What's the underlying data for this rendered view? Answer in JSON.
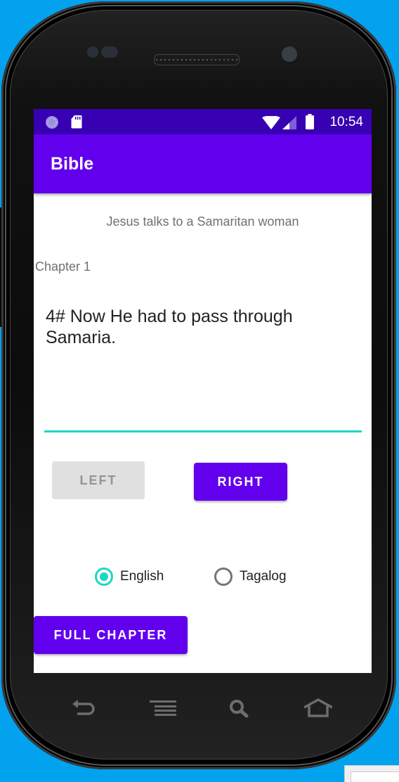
{
  "status_bar": {
    "time": "10:54",
    "left_icons": [
      "sync-icon",
      "sd-card-icon"
    ],
    "right_icons": [
      "wifi-icon",
      "signal-icon",
      "battery-icon"
    ]
  },
  "app_bar": {
    "title": "Bible"
  },
  "content": {
    "subtitle": "Jesus talks to a Samaritan woman",
    "chapter_label": "Chapter 1",
    "verse_text": "4# Now He had to pass through Samaria.",
    "buttons": {
      "left": "LEFT",
      "right": "RIGHT",
      "full_chapter": "FULL CHAPTER"
    },
    "language": {
      "options": [
        {
          "label": "English",
          "selected": true
        },
        {
          "label": "Tagalog",
          "selected": false
        }
      ]
    }
  },
  "navigation": {
    "buttons": [
      "back",
      "menu",
      "search",
      "home"
    ]
  },
  "colors": {
    "primary": "#6200ee",
    "primary_dark": "#3700b3",
    "accent": "#1ed6c4",
    "background": "#03a2ef"
  }
}
